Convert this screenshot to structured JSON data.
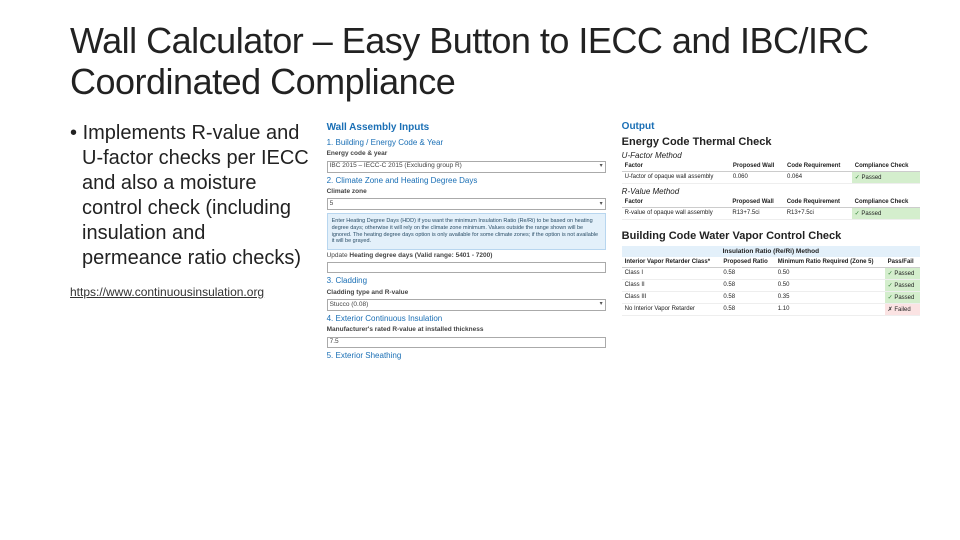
{
  "title": "Wall Calculator – Easy Button to IECC and IBC/IRC Coordinated Compliance",
  "bullet": "Implements R-value and U-factor checks per IECC and also a moisture control check (including insulation and permeance ratio checks)",
  "link": "https://www.continuousinsulation.org",
  "inputs": {
    "heading": "Wall Assembly Inputs",
    "s1": "1. Building / Energy Code & Year",
    "l1": "Energy code & year",
    "v1": "IBC 2015 – IECC-C 2015 (Excluding group R)",
    "s2": "2. Climate Zone and Heating Degree Days",
    "l2": "Climate zone",
    "v2": "5",
    "hint": "Enter Heating Degree Days (HDD) if you want the minimum Insulation Ratio (Re/Ri) to be based on heating degree days; otherwise it will rely on the climate zone minimum. Values outside the range shown will be ignored. The heating degree days option is only available for some climate zones; if the option is not available it will be grayed.",
    "l3": "Heating degree days (Valid range: 5401 - 7200)",
    "s3": "3. Cladding",
    "l4": "Cladding type and R-value",
    "v4": "Stucco (0.08)",
    "s4": "4. Exterior Continuous Insulation",
    "l5": "Manufacturer's rated R-value at installed thickness",
    "v5": "7.5",
    "s5": "5. Exterior Sheathing"
  },
  "output": {
    "heading": "Output",
    "check1": "Energy Code Thermal Check",
    "m1": "U-Factor Method",
    "t1h": [
      "Factor",
      "Proposed Wall",
      "Code Requirement",
      "Compliance Check"
    ],
    "t1r": [
      "U-factor of opaque wall assembly",
      "0.060",
      "0.064",
      "Passed"
    ],
    "m2": "R-Value Method",
    "t2h": [
      "Factor",
      "Proposed Wall",
      "Code Requirement",
      "Compliance Check"
    ],
    "t2r": [
      "R-value of opaque wall assembly",
      "R13+7.5ci",
      "R13+7.5ci",
      "Passed"
    ],
    "check2": "Building Code Water Vapor Control Check",
    "bar": "Insulation Ratio (Re/Ri) Method",
    "t3h": [
      "Interior Vapor Retarder Class*",
      "Proposed Ratio",
      "Minimum Ratio Required (Zone 5)",
      "Pass/Fail"
    ],
    "t3r1": [
      "Class I",
      "0.58",
      "0.50",
      "Passed"
    ],
    "t3r2": [
      "Class II",
      "0.58",
      "0.50",
      "Passed"
    ],
    "t3r3": [
      "Class III",
      "0.58",
      "0.35",
      "Passed"
    ],
    "t3r4": [
      "No Interior Vapor Retarder",
      "0.58",
      "1.10",
      "Failed"
    ]
  }
}
